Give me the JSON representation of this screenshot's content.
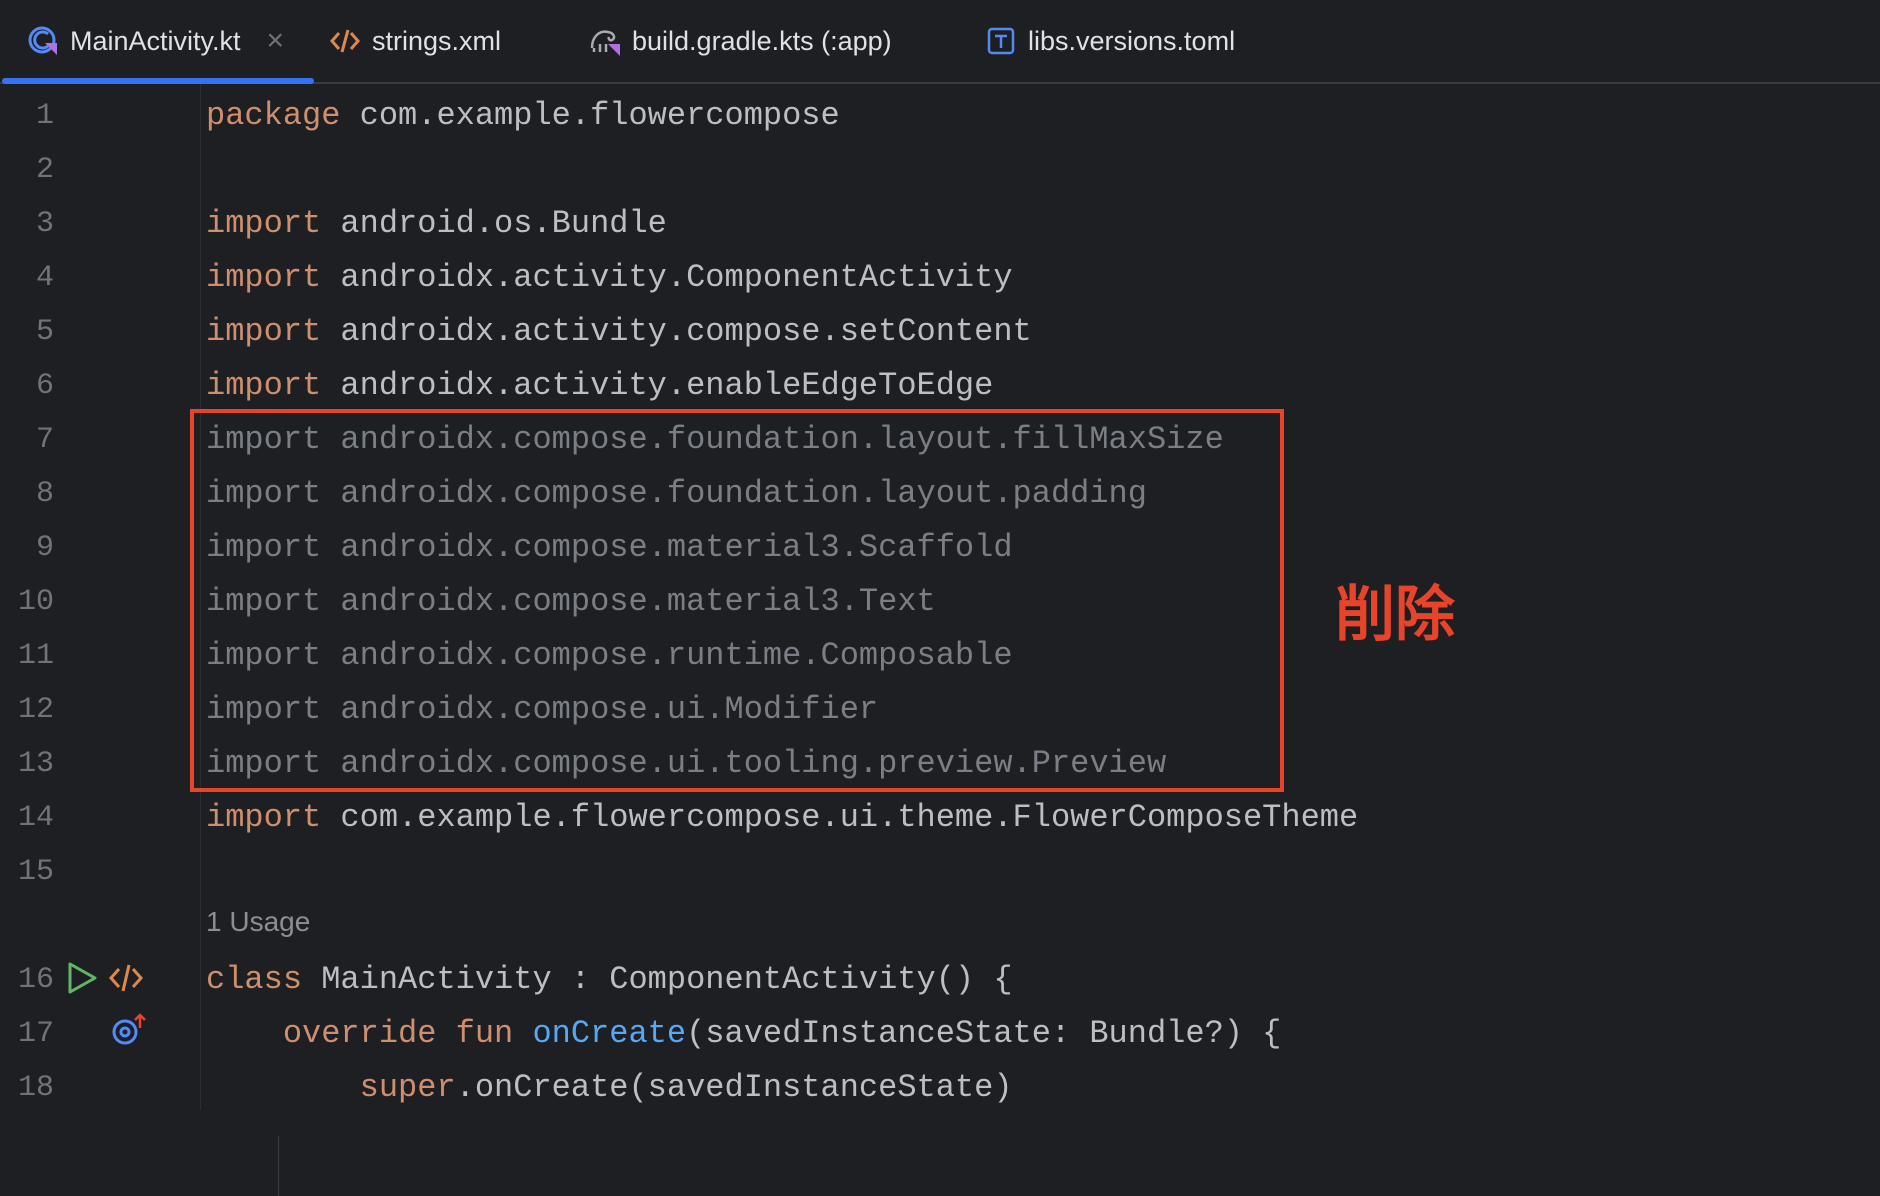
{
  "tabs": [
    {
      "label": "MainActivity.kt",
      "icon": "kotlin-class-icon",
      "active": true,
      "closable": true
    },
    {
      "label": "strings.xml",
      "icon": "xml-code-icon"
    },
    {
      "label": "build.gradle.kts (:app)",
      "icon": "gradle-kotlin-icon"
    },
    {
      "label": "libs.versions.toml",
      "icon": "toml-file-icon"
    }
  ],
  "close_glyph": "×",
  "usage_hint": "1 Usage",
  "annotation": {
    "text": "削除",
    "color": "#e8442a"
  },
  "colors": {
    "background": "#1e1f22",
    "keyword": "#cf8e6d",
    "identifier": "#bcbec4",
    "function": "#56a8f5",
    "unused_import": "#7a7e85",
    "line_number": "#6f737a",
    "accent": "#3574f0"
  },
  "lines": [
    {
      "n": "1",
      "kw": "package",
      "rest": " com.example.flowercompose"
    },
    {
      "n": "2",
      "kw": "",
      "rest": ""
    },
    {
      "n": "3",
      "kw": "import",
      "rest": " android.os.Bundle"
    },
    {
      "n": "4",
      "kw": "import",
      "rest": " androidx.activity.ComponentActivity"
    },
    {
      "n": "5",
      "kw": "import",
      "rest": " androidx.activity.compose.setContent"
    },
    {
      "n": "6",
      "kw": "import",
      "rest": " androidx.activity.enableEdgeToEdge"
    },
    {
      "n": "7",
      "text": "import androidx.compose.foundation.layout.fillMaxSize"
    },
    {
      "n": "8",
      "text": "import androidx.compose.foundation.layout.padding"
    },
    {
      "n": "9",
      "text": "import androidx.compose.material3.Scaffold"
    },
    {
      "n": "10",
      "text": "import androidx.compose.material3.Text"
    },
    {
      "n": "11",
      "text": "import androidx.compose.runtime.Composable"
    },
    {
      "n": "12",
      "text": "import androidx.compose.ui.Modifier"
    },
    {
      "n": "13",
      "text": "import androidx.compose.ui.tooling.preview.Preview"
    },
    {
      "n": "14",
      "kw": "import",
      "rest": " com.example.flowercompose.ui.theme.FlowerComposeTheme"
    },
    {
      "n": "15",
      "kw": "",
      "rest": ""
    },
    {
      "n": "16",
      "kw": "class",
      "rest": " MainActivity : ComponentActivity() {"
    },
    {
      "n": "17",
      "indent": "    ",
      "kw": "override fun",
      "fn": " onCreate",
      "rest": "(savedInstanceState: Bundle?) {"
    },
    {
      "n": "18",
      "indent": "        ",
      "kw": "super",
      "rest": ".onCreate(savedInstanceState)"
    }
  ]
}
